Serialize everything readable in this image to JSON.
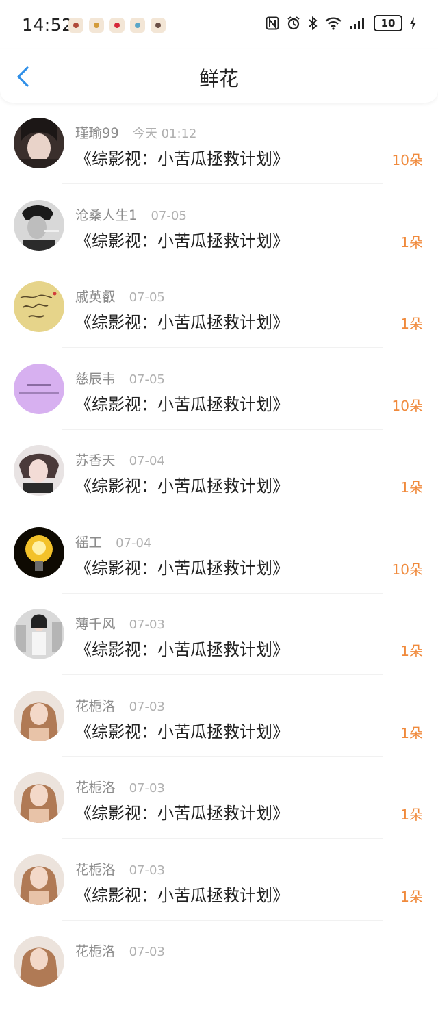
{
  "status_bar": {
    "time": "14:52",
    "battery": "10",
    "notification_icons": [
      "app-icon",
      "app-icon",
      "app-icon",
      "app-icon",
      "app-icon"
    ]
  },
  "header": {
    "title": "鲜花"
  },
  "colors": {
    "accent": "#2f8fe8",
    "count": "#f08a3c",
    "text": "#222222",
    "meta": "#999999"
  },
  "rows": [
    {
      "name": "瑾瑜99",
      "time": "今天 01:12",
      "book": "《综影视：小苦瓜拯救计划》",
      "count": "10朵",
      "avatar": "avatar-dark-hair"
    },
    {
      "name": "沧桑人生1",
      "time": "07-05",
      "book": "《综影视：小苦瓜拯救计划》",
      "count": "1朵",
      "avatar": "avatar-monochrome"
    },
    {
      "name": "戚英叡",
      "time": "07-05",
      "book": "《综影视：小苦瓜拯救计划》",
      "count": "1朵",
      "avatar": "avatar-handwriting"
    },
    {
      "name": "慈辰韦",
      "time": "07-05",
      "book": "《综影视：小苦瓜拯救计划》",
      "count": "10朵",
      "avatar": "avatar-purple-text"
    },
    {
      "name": "苏香天",
      "time": "07-04",
      "book": "《综影视：小苦瓜拯救计划》",
      "count": "1朵",
      "avatar": "avatar-portrait"
    },
    {
      "name": "徭工",
      "time": "07-04",
      "book": "《综影视：小苦瓜拯救计划》",
      "count": "10朵",
      "avatar": "avatar-lightbulb"
    },
    {
      "name": "薄千风",
      "time": "07-03",
      "book": "《综影视：小苦瓜拯救计划》",
      "count": "1朵",
      "avatar": "avatar-crowd"
    },
    {
      "name": "花栀洛",
      "time": "07-03",
      "book": "《综影视：小苦瓜拯救计划》",
      "count": "1朵",
      "avatar": "avatar-portrait-warm"
    },
    {
      "name": "花栀洛",
      "time": "07-03",
      "book": "《综影视：小苦瓜拯救计划》",
      "count": "1朵",
      "avatar": "avatar-portrait-warm"
    },
    {
      "name": "花栀洛",
      "time": "07-03",
      "book": "《综影视：小苦瓜拯救计划》",
      "count": "1朵",
      "avatar": "avatar-portrait-warm"
    },
    {
      "name": "花栀洛",
      "time": "07-03",
      "book": "",
      "count": "",
      "avatar": "avatar-portrait-warm"
    }
  ]
}
